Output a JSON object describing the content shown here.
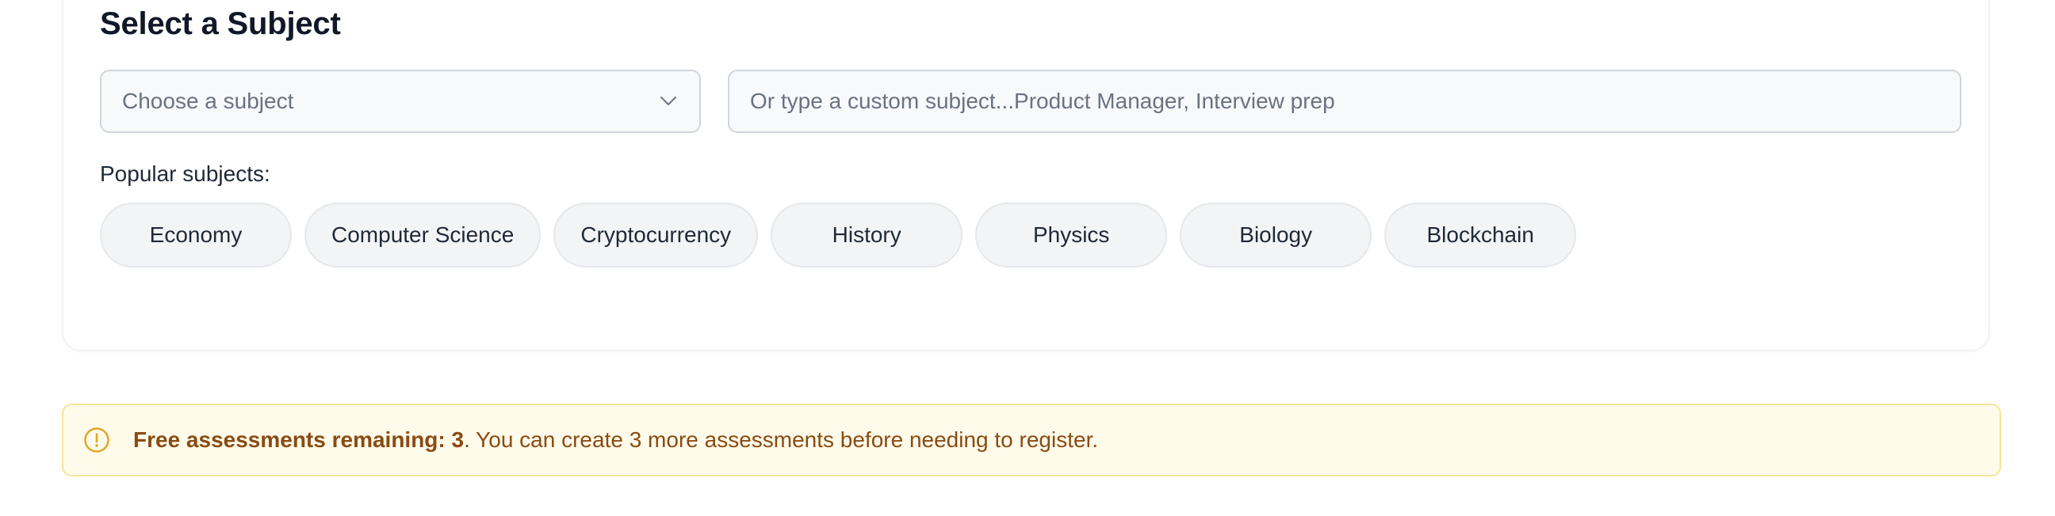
{
  "section": {
    "title": "Select a Subject"
  },
  "subject_select": {
    "placeholder": "Choose a subject",
    "icon": "chevron-down-icon"
  },
  "custom_subject": {
    "placeholder": "Or type a custom subject...Product Manager, Interview prep",
    "value": ""
  },
  "popular": {
    "label": "Popular subjects:",
    "chips": [
      "Economy",
      "Computer Science",
      "Cryptocurrency",
      "History",
      "Physics",
      "Biology",
      "Blockchain"
    ]
  },
  "notice": {
    "icon": "alert-circle-icon",
    "strong_text": "Free assessments remaining: 3",
    "rest_text": ". You can create 3 more assessments before needing to register."
  },
  "colors": {
    "notice_bg": "#fefbea",
    "notice_border": "#f6e59a",
    "notice_text": "#8a4b13",
    "notice_icon": "#e0a526",
    "chip_bg": "#f3f4f6"
  }
}
